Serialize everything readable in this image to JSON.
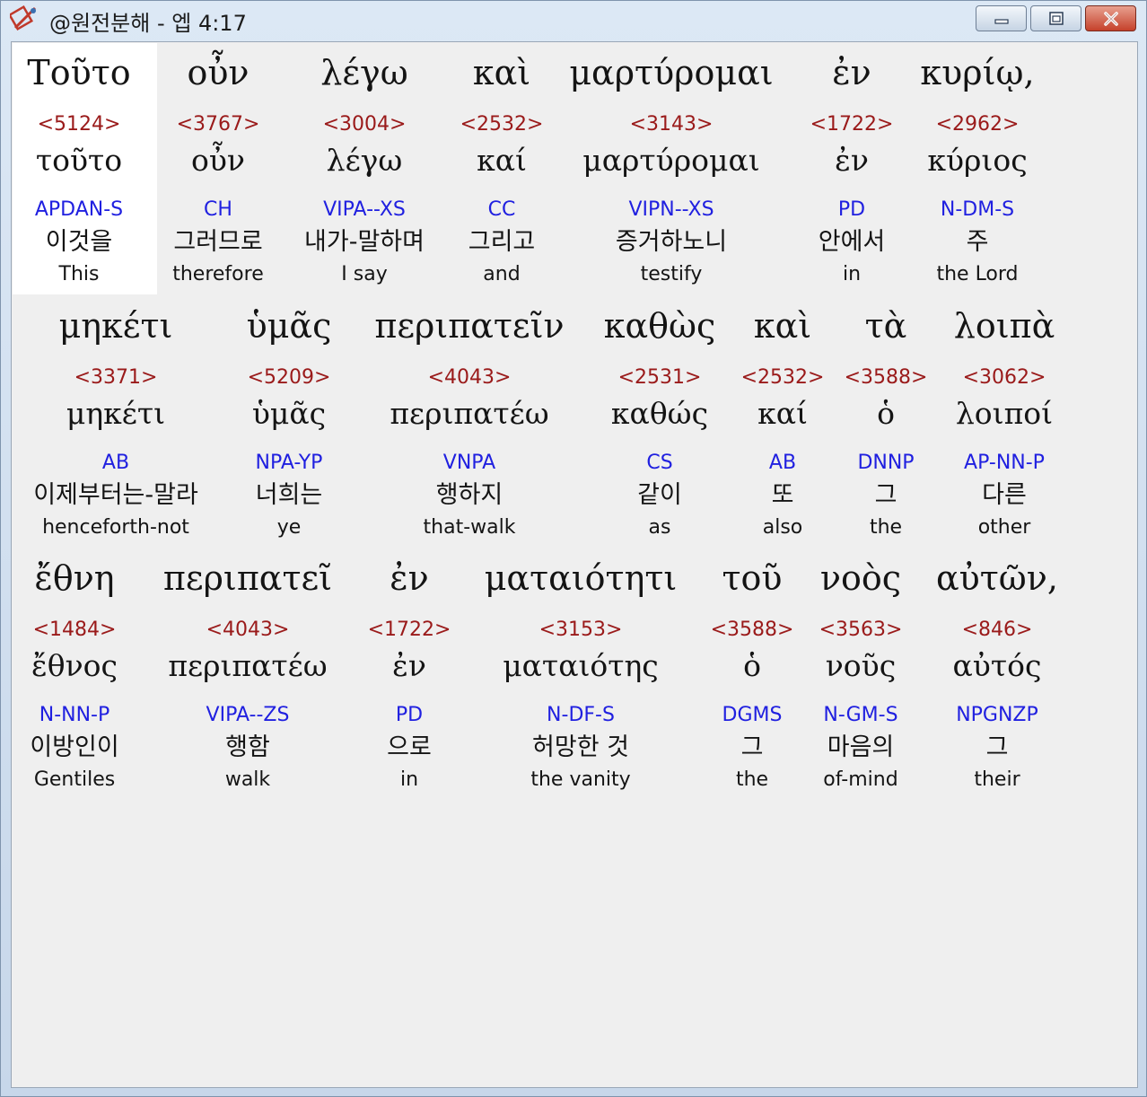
{
  "window": {
    "title": "@원전분해 - 엡 4:17",
    "icon": "compass-pen-icon",
    "minimize_icon": "minimize-icon",
    "maximize_icon": "maximize-icon",
    "close_icon": "close-icon"
  },
  "rows": [
    [
      {
        "greek": "Τοῦτο",
        "strong": "<5124>",
        "lemma": "τοῦτο",
        "morph": "APDAN-S",
        "korean": "이것을",
        "english": "This",
        "selected": true
      },
      {
        "greek": "οὖν",
        "strong": "<3767>",
        "lemma": "οὖν",
        "morph": "CH",
        "korean": "그러므로",
        "english": "therefore"
      },
      {
        "greek": "λέγω",
        "strong": "<3004>",
        "lemma": "λέγω",
        "morph": "VIPA--XS",
        "korean": "내가-말하며",
        "english": "I say"
      },
      {
        "greek": "καὶ",
        "strong": "<2532>",
        "lemma": "καί",
        "morph": "CC",
        "korean": "그리고",
        "english": "and"
      },
      {
        "greek": "μαρτύρομαι",
        "strong": "<3143>",
        "lemma": "μαρτύρομαι",
        "morph": "VIPN--XS",
        "korean": "증거하노니",
        "english": "testify"
      },
      {
        "greek": "ἐν",
        "strong": "<1722>",
        "lemma": "ἐν",
        "morph": "PD",
        "korean": "안에서",
        "english": "in"
      },
      {
        "greek": "κυρίῳ,",
        "strong": "<2962>",
        "lemma": "κύριος",
        "morph": "N-DM-S",
        "korean": "주",
        "english": "the Lord"
      }
    ],
    [
      {
        "greek": "μηκέτι",
        "strong": "<3371>",
        "lemma": "μηκέτι",
        "morph": "AB",
        "korean": "이제부터는-말라",
        "english": "henceforth-not"
      },
      {
        "greek": "ὑμᾶς",
        "strong": "<5209>",
        "lemma": "ὑμᾶς",
        "morph": "NPA-YP",
        "korean": "너희는",
        "english": "ye"
      },
      {
        "greek": "περιπατεῖν",
        "strong": "<4043>",
        "lemma": "περιπατέω",
        "morph": "VNPA",
        "korean": "행하지",
        "english": "that-walk"
      },
      {
        "greek": "καθὼς",
        "strong": "<2531>",
        "lemma": "καθώς",
        "morph": "CS",
        "korean": "같이",
        "english": "as"
      },
      {
        "greek": "καὶ",
        "strong": "<2532>",
        "lemma": "καί",
        "morph": "AB",
        "korean": "또",
        "english": "also"
      },
      {
        "greek": "τὰ",
        "strong": "<3588>",
        "lemma": "ὁ",
        "morph": "DNNP",
        "korean": "그",
        "english": "the"
      },
      {
        "greek": "λοιπὰ",
        "strong": "<3062>",
        "lemma": "λοιποί",
        "morph": "AP-NN-P",
        "korean": "다른",
        "english": "other"
      }
    ],
    [
      {
        "greek": "ἔθνη",
        "strong": "<1484>",
        "lemma": "ἔθνος",
        "morph": "N-NN-P",
        "korean": "이방인이",
        "english": "Gentiles"
      },
      {
        "greek": "περιπατεῖ",
        "strong": "<4043>",
        "lemma": "περιπατέω",
        "morph": "VIPA--ZS",
        "korean": "행함",
        "english": "walk"
      },
      {
        "greek": "ἐν",
        "strong": "<1722>",
        "lemma": "ἐν",
        "morph": "PD",
        "korean": "으로",
        "english": "in"
      },
      {
        "greek": "ματαιότητι",
        "strong": "<3153>",
        "lemma": "ματαιότης",
        "morph": "N-DF-S",
        "korean": "허망한 것",
        "english": "the vanity"
      },
      {
        "greek": "τοῦ",
        "strong": "<3588>",
        "lemma": "ὁ",
        "morph": "DGMS",
        "korean": "그",
        "english": "the"
      },
      {
        "greek": "νοὸς",
        "strong": "<3563>",
        "lemma": "νοῦς",
        "morph": "N-GM-S",
        "korean": "마음의",
        "english": "of-mind"
      },
      {
        "greek": "αὐτῶν,",
        "strong": "<846>",
        "lemma": "αὐτός",
        "morph": "NPGNZP",
        "korean": "그",
        "english": "their"
      }
    ]
  ]
}
